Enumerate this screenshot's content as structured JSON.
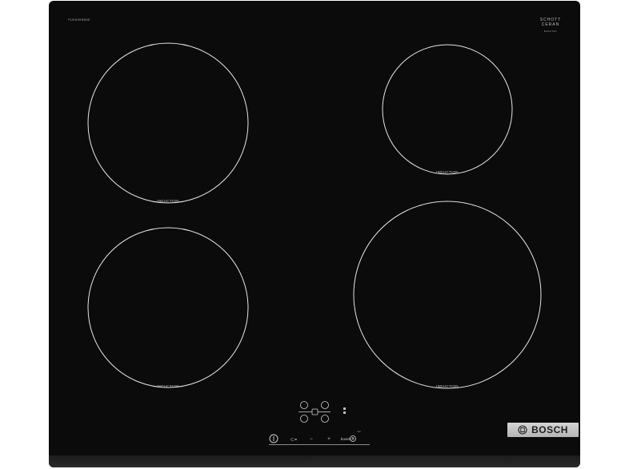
{
  "model_number": "PUE63RBB5E",
  "brand_panel": {
    "glass_brand_line1": "SCHOTT",
    "glass_brand_line2": "CERAN",
    "glass_sub": "BASOTEC",
    "brand_name": "BOSCH"
  },
  "zones": [
    {
      "label": "INDUCTION"
    },
    {
      "label": "INDUCTION"
    },
    {
      "label": "INDUCTION"
    },
    {
      "label": "INDUCTION"
    }
  ],
  "controls": {
    "power_icon": "power-icon",
    "select_label": "⊂=",
    "minus_label": "−",
    "plus_label": "+",
    "boost_label": "boost ①",
    "timer_icon": "timer-icon",
    "lock_label": "◘◘",
    "indicator_label": "min"
  },
  "colors": {
    "glass": "#0b0b0b",
    "ring": "#e6e6e6",
    "badge": "#c6c6c6"
  }
}
